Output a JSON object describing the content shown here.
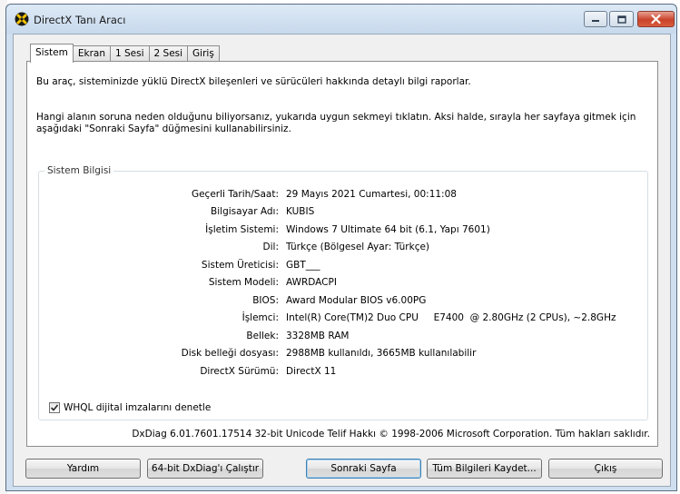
{
  "window": {
    "title": "DirectX Tanı Aracı"
  },
  "tabs": [
    {
      "label": "Sistem",
      "active": true
    },
    {
      "label": "Ekran",
      "active": false
    },
    {
      "label": "1 Sesi",
      "active": false
    },
    {
      "label": "2 Sesi",
      "active": false
    },
    {
      "label": "Giriş",
      "active": false
    }
  ],
  "intro": {
    "line1": "Bu araç, sisteminizde yüklü DirectX bileşenleri ve sürücüleri hakkında detaylı bilgi raporlar.",
    "line2": "Hangi alanın soruna neden olduğunu biliyorsanız, yukarıda uygun sekmeyi tıklatın.  Aksi halde, sırayla her sayfaya gitmek için aşağıdaki \"Sonraki Sayfa\" düğmesini kullanabilirsiniz."
  },
  "system_info": {
    "group_title": "Sistem Bilgisi",
    "rows": [
      {
        "label": "Geçerli Tarih/Saat:",
        "value": "29 Mayıs 2021 Cumartesi, 00:11:08"
      },
      {
        "label": "Bilgisayar Adı:",
        "value": "KUBIS"
      },
      {
        "label": "İşletim Sistemi:",
        "value": "Windows 7 Ultimate 64 bit (6.1, Yapı 7601)"
      },
      {
        "label": "Dil:",
        "value": "Türkçe (Bölgesel Ayar: Türkçe)"
      },
      {
        "label": "Sistem Üreticisi:",
        "value": "GBT___"
      },
      {
        "label": "Sistem Modeli:",
        "value": "AWRDACPI"
      },
      {
        "label": "BIOS:",
        "value": "Award Modular BIOS v6.00PG"
      },
      {
        "label": "İşlemci:",
        "value": "Intel(R) Core(TM)2 Duo CPU     E7400  @ 2.80GHz (2 CPUs), ~2.8GHz"
      },
      {
        "label": "Bellek:",
        "value": "3328MB RAM"
      },
      {
        "label": "Disk belleği dosyası:",
        "value": "2988MB kullanıldı, 3665MB kullanılabilir"
      },
      {
        "label": "DirectX Sürümü:",
        "value": "DirectX 11"
      }
    ]
  },
  "whql": {
    "label": "WHQL dijital imzalarını denetle",
    "checked": true
  },
  "copyright": "DxDiag 6.01.7601.17514 32-bit Unicode  Telif Hakkı © 1998-2006 Microsoft Corporation.  Tüm hakları saklıdır.",
  "buttons": {
    "help": "Yardım",
    "run64": "64-bit DxDiag'ı Çalıştır",
    "next": "Sonraki Sayfa",
    "save": "Tüm Bilgileri Kaydet...",
    "exit": "Çıkış"
  },
  "colors": {
    "frame": "#cfdfef",
    "client": "#f0f0f0",
    "close_button": "#c9432a"
  }
}
